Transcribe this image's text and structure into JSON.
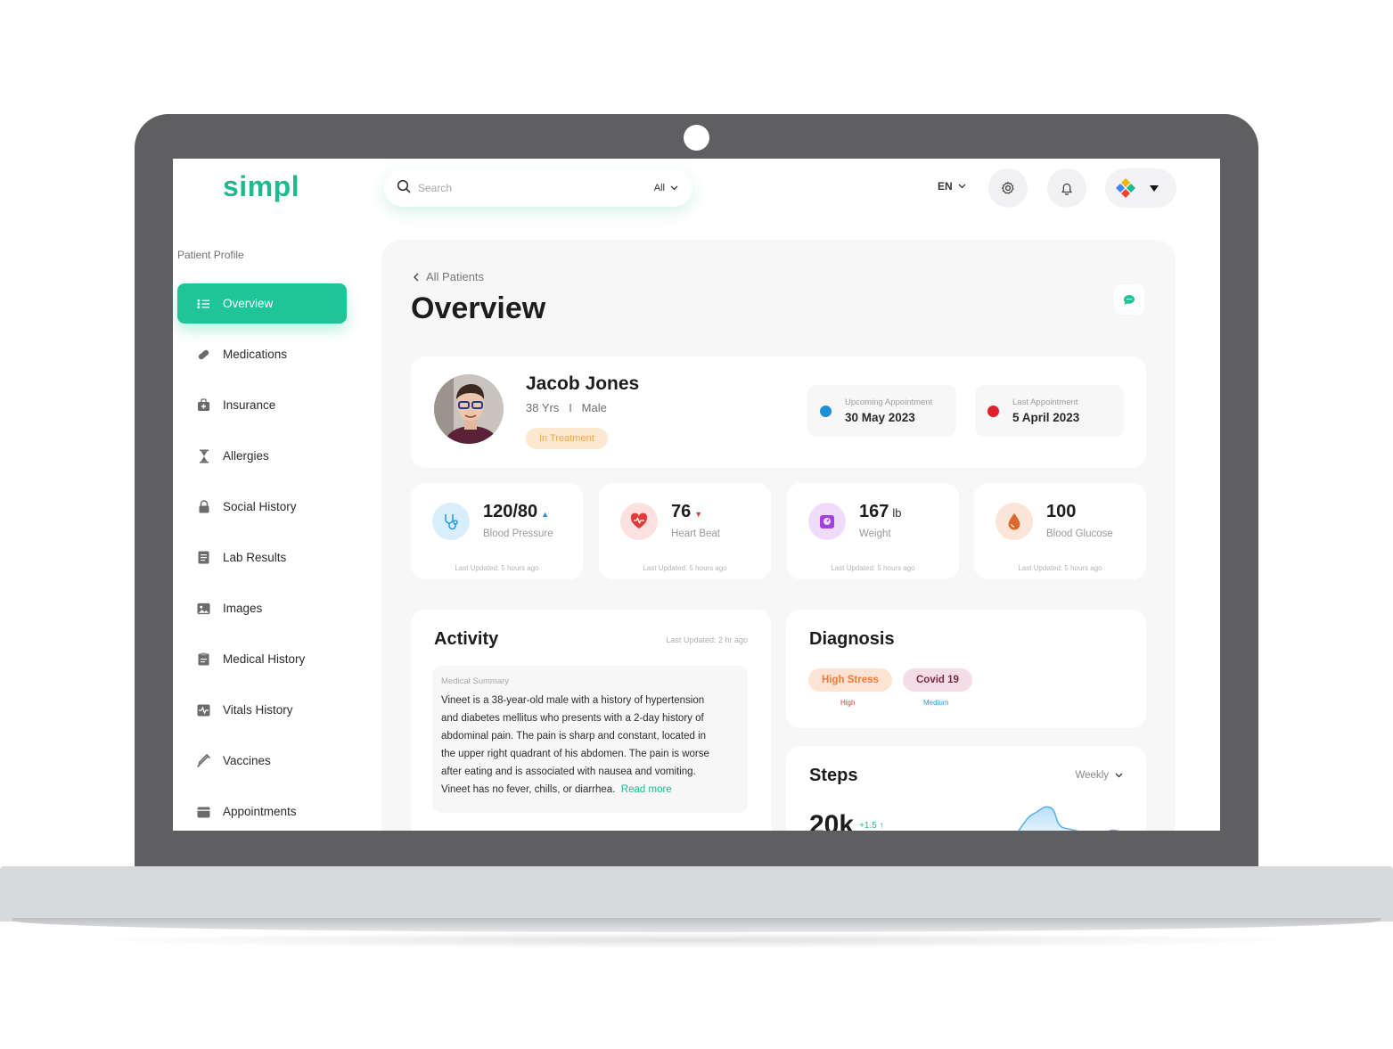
{
  "app": {
    "logo": "simpl"
  },
  "header": {
    "search_placeholder": "Search",
    "search_filter": "All",
    "language": "EN"
  },
  "sidebar": {
    "title": "Patient Profile",
    "items": [
      {
        "label": "Overview",
        "icon": "list-icon",
        "active": true
      },
      {
        "label": "Medications",
        "icon": "pill-icon"
      },
      {
        "label": "Insurance",
        "icon": "insurance-icon"
      },
      {
        "label": "Allergies",
        "icon": "hourglass-icon"
      },
      {
        "label": "Social History",
        "icon": "lock-icon"
      },
      {
        "label": "Lab Results",
        "icon": "document-icon"
      },
      {
        "label": "Images",
        "icon": "image-icon"
      },
      {
        "label": "Medical History",
        "icon": "clipboard-icon"
      },
      {
        "label": "Vitals History",
        "icon": "pulse-icon"
      },
      {
        "label": "Vaccines",
        "icon": "syringe-icon"
      },
      {
        "label": "Appointments",
        "icon": "calendar-icon"
      }
    ]
  },
  "main": {
    "back_label": "All Patients",
    "title": "Overview",
    "patient": {
      "name": "Jacob Jones",
      "age": "38 Yrs",
      "separator": "I",
      "gender": "Male",
      "status": "In Treatment",
      "upcoming_label": "Upcoming Appointment",
      "upcoming_value": "30 May 2023",
      "last_label": "Last Appointment",
      "last_value": "5 April 2023"
    },
    "vitals": [
      {
        "value": "120/80",
        "unit": "",
        "trend": "▲",
        "trend_color": "#1f8fd6",
        "label": "Blood Pressure",
        "updated": "Last Updated: 5 hours ago",
        "icon": "stethoscope-icon",
        "icon_bg": "#d9eefb",
        "icon_color": "#2d9be0"
      },
      {
        "value": "76",
        "unit": "",
        "trend": "▼",
        "trend_color": "#e23b3b",
        "label": "Heart Beat",
        "updated": "Last Updated: 5 hours ago",
        "icon": "heart-icon",
        "icon_bg": "#fde1e1",
        "icon_color": "#e23b3b"
      },
      {
        "value": "167",
        "unit": "lb",
        "trend": "",
        "trend_color": "",
        "label": "Weight",
        "updated": "Last Updated: 5 hours ago",
        "icon": "scale-icon",
        "icon_bg": "#efdcfb",
        "icon_color": "#a23fe0"
      },
      {
        "value": "100",
        "unit": "",
        "trend": "",
        "trend_color": "",
        "label": "Blood Glucose",
        "updated": "Last Updated: 5 hours ago",
        "icon": "drop-icon",
        "icon_bg": "#fbe5d8",
        "icon_color": "#d96a2a"
      }
    ],
    "activity": {
      "title": "Activity",
      "updated": "Last Updated: 2 hr ago",
      "summary_label": "Medical Summary",
      "summary_lines": [
        "Vineet is a 38-year-old male with a history of hypertension",
        "and diabetes mellitus who presents with a 2-day history of",
        "abdominal pain. The pain is sharp and constant, located in",
        "the upper right quadrant of his abdomen. The pain is worse",
        "after eating and is associated with nausea and vomiting.",
        "Vineet has no fever, chills, or diarrhea."
      ],
      "read_more": "Read more"
    },
    "diagnosis": {
      "title": "Diagnosis",
      "tags": [
        {
          "label": "High Stress",
          "level": "High",
          "bg": "#fde3d3",
          "color": "#f07a3a",
          "level_color": "#e23b3b"
        },
        {
          "label": "Covid 19",
          "level": "Medium",
          "bg": "#f4dde6",
          "color": "#7a2b45",
          "level_color": "#2d9be0"
        }
      ]
    },
    "steps": {
      "title": "Steps",
      "filter": "Weekly",
      "value": "20k",
      "delta": "+1.5 ↑"
    }
  },
  "colors": {
    "accent": "#1fc598",
    "upcoming_dot": "#1f8fd6",
    "last_dot": "#e0202a"
  }
}
